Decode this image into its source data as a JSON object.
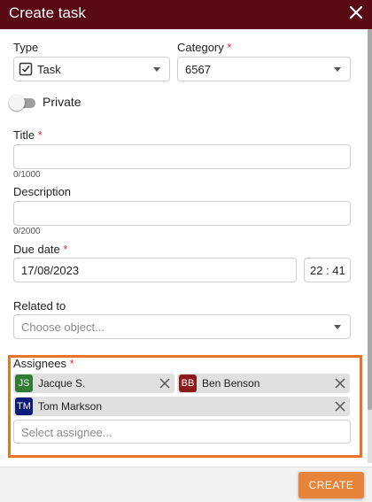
{
  "dialog": {
    "title": "Create task"
  },
  "type_field": {
    "label": "Type",
    "value": "Task"
  },
  "category_field": {
    "label": "Category",
    "required_mark": "*",
    "value": "6567"
  },
  "private_toggle": {
    "label": "Private",
    "on": false
  },
  "title_field": {
    "label": "Title",
    "required_mark": "*",
    "value": "",
    "counter": "0/1000"
  },
  "description_field": {
    "label": "Description",
    "value": "",
    "counter": "0/2000"
  },
  "due_date": {
    "label": "Due date",
    "required_mark": "*",
    "date": "17/08/2023",
    "time": "22 : 41"
  },
  "related_to": {
    "label": "Related to",
    "placeholder": "Choose object..."
  },
  "assignees": {
    "label": "Assignees",
    "required_mark": "*",
    "placeholder": "Select assignee...",
    "chips": [
      {
        "initials": "JS",
        "name": "Jacque S.",
        "color": "#2e7d32"
      },
      {
        "initials": "BB",
        "name": "Ben Benson",
        "color": "#8b1a1a"
      },
      {
        "initials": "TM",
        "name": "Tom Markson",
        "color": "#0d1b7a"
      }
    ]
  },
  "footer": {
    "create_label": "CREATE"
  },
  "colors": {
    "titlebar": "#5a0a14",
    "accent": "#e8833a",
    "highlight": "#e8742a",
    "required": "#d32f2f"
  }
}
